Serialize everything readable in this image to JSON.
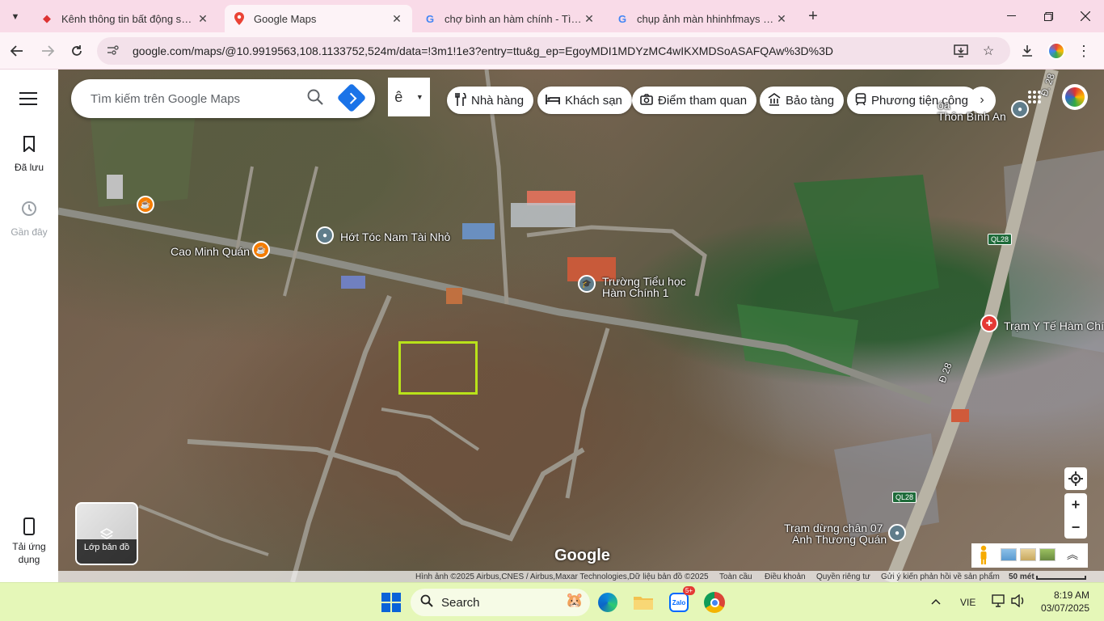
{
  "browser": {
    "tabs": [
      {
        "title": "Kênh thông tin bất động sản - Mu",
        "close": "✕"
      },
      {
        "title": "Google Maps",
        "close": "✕"
      },
      {
        "title": "chợ bình an hàm chính - Tìm trên",
        "close": "✕"
      },
      {
        "title": "chụp ảnh màn hhinhfmays tính -",
        "close": "✕"
      }
    ],
    "new_tab": "+",
    "url": "google.com/maps/@10.9919563,108.1133752,524m/data=!3m1!1e3?entry=ttu&g_ep=EgoyMDI1MDYzMC4wIKXMDSoASAFQAw%3D%3D"
  },
  "rail": {
    "saved_label": "Đã lưu",
    "recent_label": "Gần đây",
    "apps_label": "Tải ứng dụng"
  },
  "search": {
    "placeholder": "Tìm kiếm trên Google Maps"
  },
  "lang_button": "ê",
  "chips": [
    {
      "label": "Nhà hàng"
    },
    {
      "label": "Khách sạn"
    },
    {
      "label": "Điểm tham quan"
    },
    {
      "label": "Bảo tàng"
    },
    {
      "label": "Phương tiện công"
    }
  ],
  "map_labels": {
    "thon_binh_an_1": "Thôn Bình An",
    "hot_toc": "Hớt Tóc Nam Tài Nhỏ",
    "cao_minh_quan": "Cao Minh Quán",
    "truong_line1": "Trường Tiểu học",
    "truong_line2": "Hàm Chính 1",
    "tram_y_te": "Trạm Y Tế Hàm Chí",
    "tram_dung_line1": "Trạm dừng chân 07",
    "tram_dung_line2": "Anh Thương Quán",
    "ql28_a": "QL28",
    "ql28_b": "QL28",
    "d28_a": "Đ. 28",
    "d28_b": "Đ 28",
    "oa": "óa"
  },
  "layers_label": "Lớp bản đồ",
  "google_logo": "Google",
  "attribution": {
    "imagery": "Hình ảnh ©2025 Airbus,CNES / Airbus,Maxar Technologies,Dữ liệu bản đồ ©2025",
    "global": "Toàn cầu",
    "terms": "Điều khoản",
    "privacy": "Quyền riêng tư",
    "feedback": "Gửi ý kiến phản hồi về sản phẩm",
    "scale": "50 mét"
  },
  "taskbar": {
    "search_label": "Search",
    "zalo_badge": "5+",
    "lang": "VIE",
    "time": "8:19 AM",
    "date": "03/07/2025"
  },
  "colors": {
    "tabstrip": "#f9dbe8",
    "taskbar": "#e5f7b8",
    "selection_box": "#b9e21a",
    "maps_blue": "#1a73e8"
  }
}
